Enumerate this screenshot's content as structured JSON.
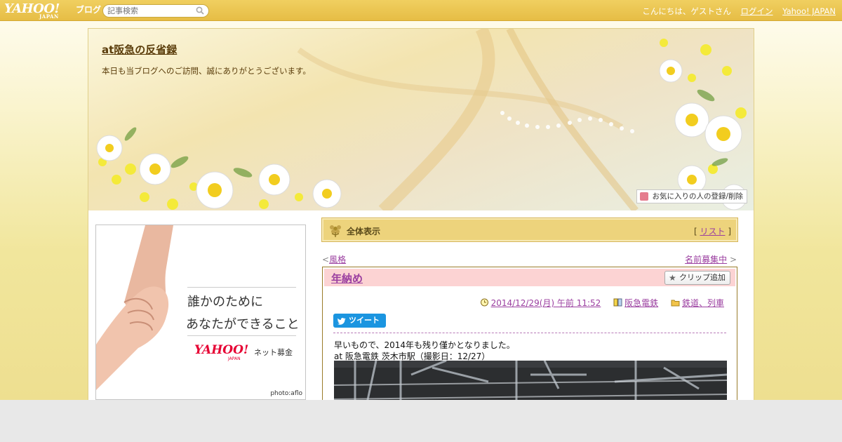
{
  "topbar": {
    "logo_main": "YAHOO!",
    "logo_sub": "JAPAN",
    "logo_blog": "ブログ",
    "search_placeholder": "記事検索",
    "greeting": "こんにちは、ゲストさん",
    "login": "ログイン",
    "yahoo_japan": "Yahoo! JAPAN"
  },
  "header": {
    "blog_title": "at阪急の反省録",
    "description": "本日も当ブログへのご訪問、誠にありがとうございます。",
    "favorite_button": "お気に入りの人の登録/削除"
  },
  "ad": {
    "line1": "誰かのために",
    "line2": "あなたができること",
    "logo": "YAHOO!",
    "logo_sub": "JAPAN",
    "tag": "ネット募金",
    "credit": "photo:aflo"
  },
  "content": {
    "all_label": "全体表示",
    "list_link": "リスト",
    "prev_link": "風格",
    "next_link": "名前募集中"
  },
  "post": {
    "title": "年納め",
    "clip_button": "クリップ追加",
    "datetime": "2014/12/29(月) 午前 11:52",
    "category": "阪急電鉄",
    "folder": "鉄道、列車",
    "tweet_button": "ツイート",
    "body_line1": "早いもので、2014年も残り僅かとなりました。",
    "body_line2": "at 阪急電鉄 茨木市駅（撮影日：12/27）"
  },
  "colors": {
    "topbar": "#e6bd45",
    "link": "#9b3fa0",
    "post_head": "#fcd3d3",
    "all_bar": "#edd37c",
    "tweet": "#1b95e0"
  }
}
